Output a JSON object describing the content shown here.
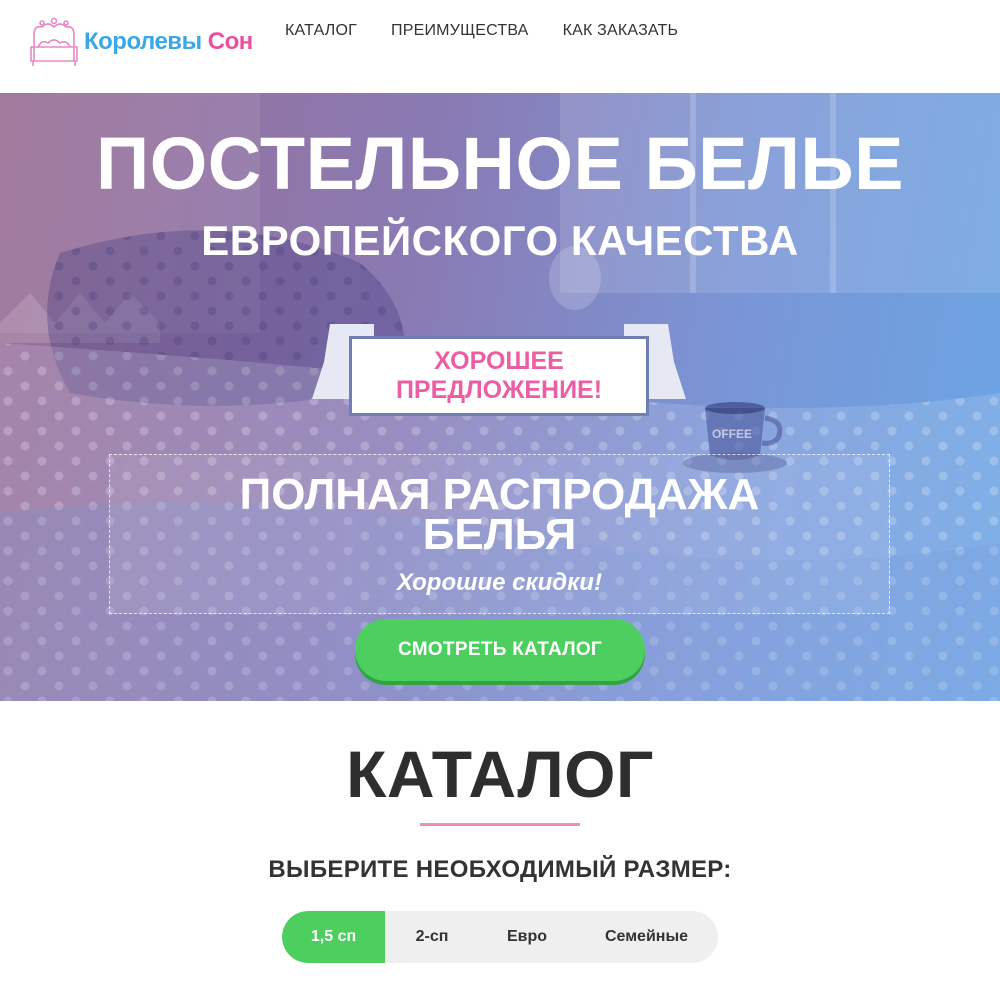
{
  "header": {
    "logo": {
      "word1": "Королевы",
      "word2": "Сон"
    },
    "nav": [
      {
        "label": "КАТАЛОГ"
      },
      {
        "label": "ПРЕИМУЩЕСТВА"
      },
      {
        "label": "КАК ЗАКАЗАТЬ"
      }
    ]
  },
  "hero": {
    "title": "ПОСТЕЛЬНОЕ БЕЛЬЕ",
    "subtitle": "ЕВРОПЕЙСКОГО КАЧЕСТВА",
    "ribbon_text": "ХОРОШЕЕ ПРЕДЛОЖЕНИЕ!",
    "promo_title": "ПОЛНАЯ РАСПРОДАЖА БЕЛЬЯ",
    "promo_subtitle": "Хорошие скидки!",
    "cta_label": "СМОТРЕТЬ КАТАЛОГ",
    "cup_text": "OFFEE"
  },
  "catalog": {
    "title": "КАТАЛОГ",
    "subtitle": "ВЫБЕРИТЕ НЕОБХОДИМЫЙ РАЗМЕР:",
    "size_tabs": [
      {
        "label": "1,5 сп",
        "active": true
      },
      {
        "label": "2-сп",
        "active": false
      },
      {
        "label": "Евро",
        "active": false
      },
      {
        "label": "Семейные",
        "active": false
      }
    ]
  },
  "colors": {
    "accent_green": "#4ccf5f",
    "accent_pink": "#ec5ea3",
    "logo_blue": "#3aa7e6",
    "divider_pink": "#ec8fba"
  }
}
